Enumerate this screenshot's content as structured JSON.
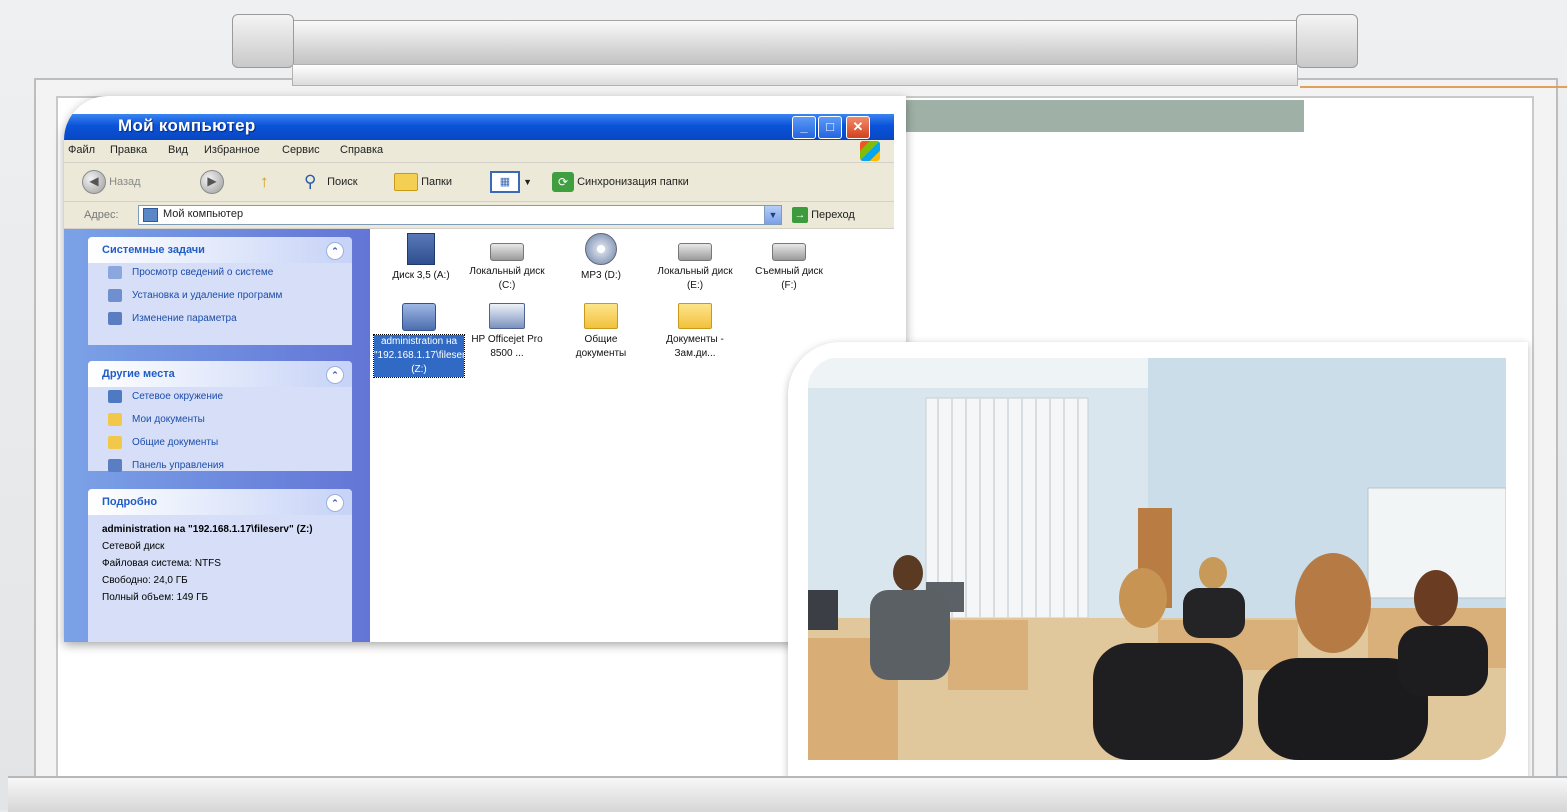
{
  "window": {
    "title": "Мой компьютер",
    "menu": [
      "Файл",
      "Правка",
      "Вид",
      "Избранное",
      "Сервис",
      "Справка"
    ],
    "controls": {
      "minimize": "_",
      "maximize": "□",
      "close": "✕"
    }
  },
  "toolbar": {
    "back": "Назад",
    "search": "Поиск",
    "folders": "Папки",
    "sync": "Синхронизация папки"
  },
  "address": {
    "label": "Адрес:",
    "value": "Мой компьютер",
    "go": "Переход"
  },
  "taskpane": {
    "system_tasks": {
      "title": "Системные задачи",
      "items": [
        {
          "label": "Просмотр сведений о системе",
          "icon": "info-icon"
        },
        {
          "label": "Установка и удаление программ",
          "icon": "install-icon"
        },
        {
          "label": "Изменение параметра",
          "icon": "control-icon"
        }
      ]
    },
    "other_places": {
      "title": "Другие места",
      "items": [
        {
          "label": "Сетевое окружение",
          "icon": "network-icon"
        },
        {
          "label": "Мои документы",
          "icon": "folder-icon"
        },
        {
          "label": "Общие документы",
          "icon": "folder-icon"
        },
        {
          "label": "Панель управления",
          "icon": "control-panel-icon"
        }
      ]
    },
    "details": {
      "title": "Подробно",
      "name": "administration на \"192.168.1.17\\fileserv\" (Z:)",
      "type": "Сетевой диск",
      "filesystem": "Файловая система: NTFS",
      "free": "Свободно: 24,0 ГБ",
      "total": "Полный объем: 149 ГБ"
    }
  },
  "files": [
    {
      "label": "Диск 3,5 (A:)",
      "icon": "floppy-icon"
    },
    {
      "label": "Локальный диск (C:)",
      "icon": "drive-icon"
    },
    {
      "label": "MP3 (D:)",
      "icon": "cd-icon"
    },
    {
      "label": "Локальный диск (E:)",
      "icon": "drive-icon"
    },
    {
      "label": "Съемный диск (F:)",
      "icon": "removable-drive-icon"
    },
    {
      "label": "administration на \"192.168.1.17\\fileserv\" (Z:)",
      "icon": "network-drive-icon",
      "selected": true
    },
    {
      "label": "HP Officejet Pro 8500 ...",
      "icon": "printer-icon"
    },
    {
      "label": "Общие документы",
      "icon": "folder-icon"
    },
    {
      "label": "Документы - Зам.ди...",
      "icon": "folder-icon"
    }
  ],
  "colors": {
    "titlebar": "#0a53d9",
    "taskpane": "#6f8ddf",
    "selection": "#316ac5"
  }
}
